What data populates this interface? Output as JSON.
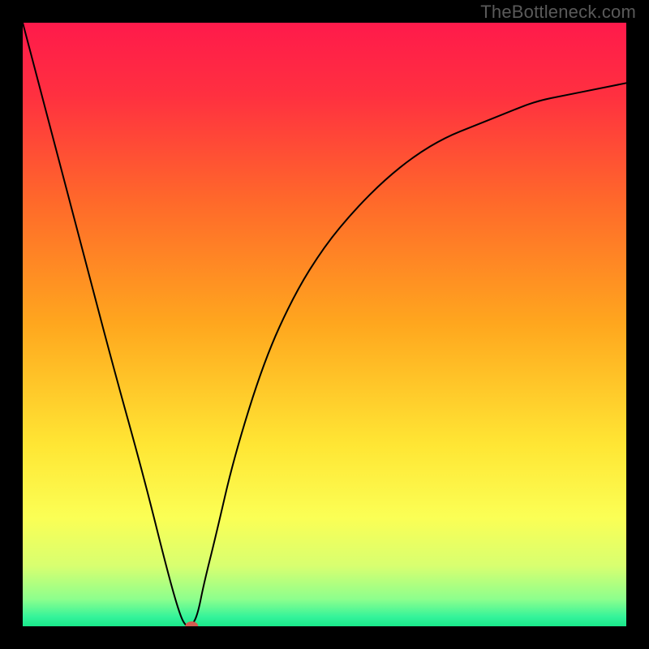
{
  "watermark": "TheBottleneck.com",
  "chart_data": {
    "type": "line",
    "title": "",
    "xlabel": "",
    "ylabel": "",
    "xlim": [
      0,
      100
    ],
    "ylim": [
      0,
      100
    ],
    "x": [
      0,
      5,
      10,
      15,
      20,
      24,
      26,
      27,
      28,
      29,
      30,
      32,
      35,
      40,
      45,
      50,
      55,
      60,
      65,
      70,
      75,
      80,
      85,
      90,
      95,
      100
    ],
    "y": [
      100,
      81,
      62,
      43,
      25,
      9,
      2,
      0,
      0,
      2,
      7,
      15,
      28,
      44,
      55,
      63,
      69,
      74,
      78,
      81,
      83,
      85,
      87,
      88,
      89,
      90
    ],
    "annotations": [
      {
        "type": "marker",
        "x": 28,
        "y": 0,
        "color": "#d45b50",
        "shape": "ellipse"
      }
    ],
    "background": {
      "type": "vertical_gradient",
      "stops": [
        {
          "offset": 0.0,
          "color": "#ff1a4b"
        },
        {
          "offset": 0.12,
          "color": "#ff3040"
        },
        {
          "offset": 0.3,
          "color": "#ff6a2a"
        },
        {
          "offset": 0.5,
          "color": "#ffa71e"
        },
        {
          "offset": 0.7,
          "color": "#ffe634"
        },
        {
          "offset": 0.82,
          "color": "#fbff55"
        },
        {
          "offset": 0.9,
          "color": "#d8ff70"
        },
        {
          "offset": 0.955,
          "color": "#8dff8d"
        },
        {
          "offset": 0.985,
          "color": "#33f39a"
        },
        {
          "offset": 1.0,
          "color": "#19e78a"
        }
      ]
    }
  }
}
